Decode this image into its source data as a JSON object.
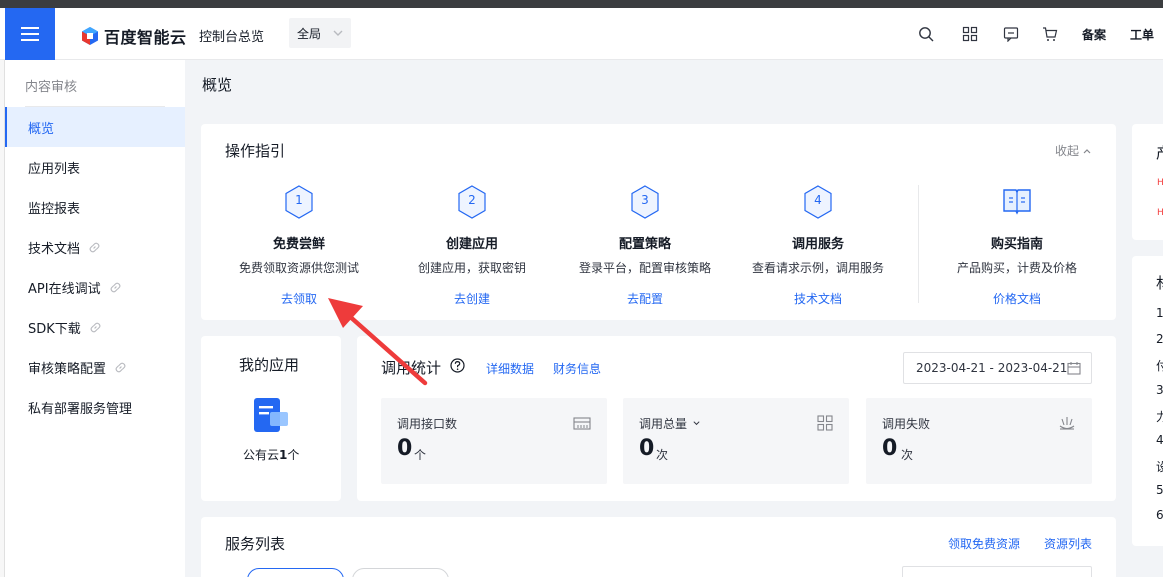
{
  "topbar": {
    "logo_text": "百度智能云",
    "nav_overview": "控制台总览",
    "region": "全局",
    "beian": "备案",
    "gongdan": "工单",
    "icons": [
      "search-icon",
      "apps-grid-icon",
      "message-icon",
      "cart-icon"
    ]
  },
  "sidebar": {
    "title": "内容审核",
    "items": [
      {
        "label": "概览",
        "active": true,
        "external": false
      },
      {
        "label": "应用列表",
        "active": false,
        "external": false
      },
      {
        "label": "监控报表",
        "active": false,
        "external": false
      },
      {
        "label": "技术文档",
        "active": false,
        "external": true
      },
      {
        "label": "API在线调试",
        "active": false,
        "external": true
      },
      {
        "label": "SDK下载",
        "active": false,
        "external": true
      },
      {
        "label": "审核策略配置",
        "active": false,
        "external": true
      },
      {
        "label": "私有部署服务管理",
        "active": false,
        "external": false
      }
    ]
  },
  "page": {
    "title": "概览"
  },
  "guide": {
    "title": "操作指引",
    "collapse": "收起",
    "steps": [
      {
        "num": "1",
        "title": "免费尝鲜",
        "desc": "免费领取资源供您测试",
        "link": "去领取"
      },
      {
        "num": "2",
        "title": "创建应用",
        "desc": "创建应用，获取密钥",
        "link": "去创建"
      },
      {
        "num": "3",
        "title": "配置策略",
        "desc": "登录平台，配置审核策略",
        "link": "去配置"
      },
      {
        "num": "4",
        "title": "调用服务",
        "desc": "查看请求示例，调用服务",
        "link": "技术文档"
      }
    ],
    "purchase": {
      "title": "购买指南",
      "desc": "产品购买，计费及价格",
      "link": "价格文档"
    }
  },
  "my_apps": {
    "title": "我的应用",
    "caption_prefix": "公有云",
    "count": "1",
    "caption_suffix": "个"
  },
  "stats": {
    "title": "调用统计",
    "detail_link": "详细数据",
    "finance_link": "财务信息",
    "date_range": "2023-04-21 - 2023-04-21",
    "boxes": [
      {
        "label": "调用接口数",
        "value": "0",
        "unit": "个"
      },
      {
        "label": "调用总量",
        "value": "0",
        "unit": "次"
      },
      {
        "label": "调用失败",
        "value": "0",
        "unit": "次"
      }
    ]
  },
  "services": {
    "title": "服务列表",
    "free_link": "领取免费资源",
    "resource_link": "资源列表"
  },
  "right_panel": {
    "card1_char": "产",
    "card2_char": "林",
    "list_chars": [
      "1",
      "2",
      "付",
      "3",
      "力",
      "4",
      "设",
      "5",
      "6"
    ]
  },
  "colors": {
    "accent": "#2468f2",
    "alert": "#f33e3e",
    "annotation_arrow": "#ee3b3b"
  }
}
